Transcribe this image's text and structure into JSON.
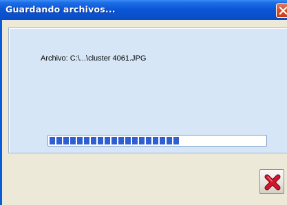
{
  "window": {
    "title": "Guardando archivos...",
    "close_icon": "close-icon"
  },
  "dialog": {
    "file_label": "Archivo: C:\\...\\cluster 4061.JPG",
    "progress_fraction": 0.6,
    "cancel_icon": "red-x-cancel-icon"
  },
  "colors": {
    "titlebar_blue": "#0a5bd8",
    "panel_bg": "#d6e6f6",
    "progress_blue": "#2f5fd0",
    "close_red": "#d8542e",
    "cancel_red": "#c8102e"
  }
}
